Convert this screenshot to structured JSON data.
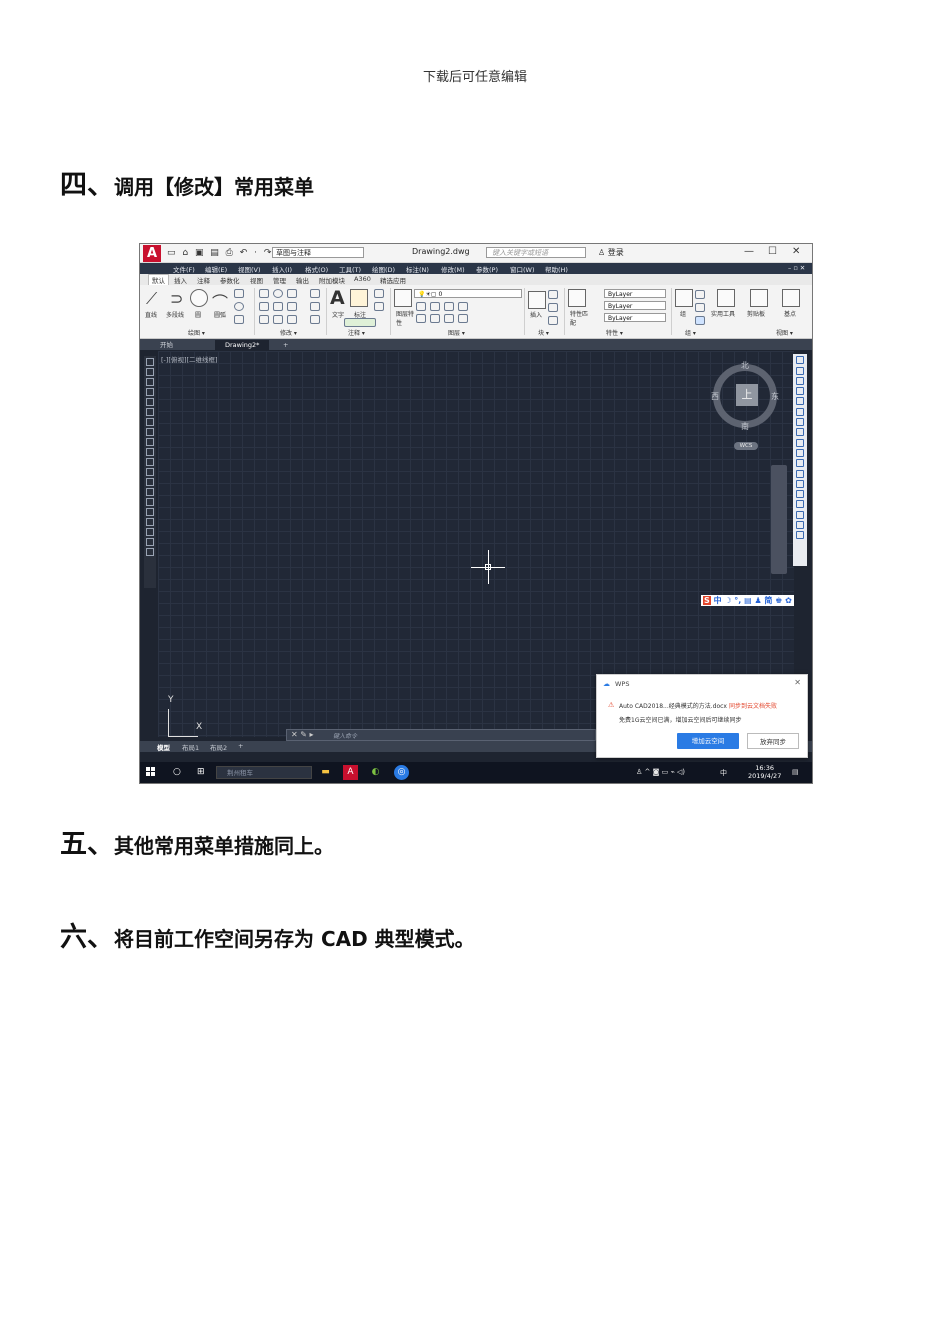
{
  "header_note": "下载后可任意编辑",
  "sections": [
    {
      "num": "四、",
      "text": "调用【修改】常用菜单"
    },
    {
      "num": "五、",
      "text": "其他常用菜单措施同上。"
    },
    {
      "num": "六、",
      "text": "将目前工作空间另存为 CAD 典型模式。"
    }
  ],
  "screenshot": {
    "logo": "A",
    "workspace": "草图与注释",
    "doc_title": "Drawing2.dwg",
    "search_placeholder": "键入关键字或短语",
    "login": "登录",
    "window_controls": [
      "—",
      "☐",
      "✕"
    ],
    "menu": [
      "文件(F)",
      "编辑(E)",
      "视图(V)",
      "插入(I)",
      "格式(O)",
      "工具(T)",
      "绘图(D)",
      "标注(N)",
      "修改(M)",
      "参数(P)",
      "窗口(W)",
      "帮助(H)"
    ],
    "ribbon_tabs": [
      "默认",
      "插入",
      "注释",
      "参数化",
      "视图",
      "管理",
      "输出",
      "附加模块",
      "A360",
      "精选应用"
    ],
    "ribbon_labels": [
      "直线",
      "多段线",
      "圆",
      "圆弧",
      "文字",
      "标注",
      "图层特性",
      "插入",
      "特性匹配",
      "组",
      "实用工具",
      "剪贴板",
      "基点"
    ],
    "ribbon_groups": [
      "绘图 ▾",
      "修改 ▾",
      "注释 ▾",
      "图层 ▾",
      "块 ▾",
      "特性 ▾",
      "组 ▾",
      "视图 ▾"
    ],
    "layer_value": "0",
    "props": [
      "ByLayer",
      "ByLayer",
      "ByLayer"
    ],
    "file_tabs": [
      "开始",
      "Drawing2*",
      "+"
    ],
    "view_label": "[-][俯视][二维线框]",
    "compass": {
      "n": "北",
      "s": "南",
      "e": "东",
      "w": "西",
      "top": "上"
    },
    "wcs": "WCS",
    "ime": "中 ☽ °, ▤ ♟ 简 ♚ ✿",
    "ucs_x": "X",
    "ucs_y": "Y",
    "cmd_placeholder": "键入命令",
    "layout_tabs": [
      "模型",
      "布局1",
      "布局2",
      "+"
    ],
    "status_model": "模型",
    "wps": {
      "title": "WPS",
      "file": "Auto CAD2018...经典模式的方法.docx",
      "sync_status": "同步到云文档失败",
      "message": "免费1G云空间已满，增加云空间后可继续同步",
      "btn_primary": "增加云空间",
      "btn_secondary": "放弃同步"
    },
    "taskbar": {
      "search": "荆州租车",
      "ime": "中",
      "time": "16:36",
      "date": "2019/4/27"
    }
  }
}
